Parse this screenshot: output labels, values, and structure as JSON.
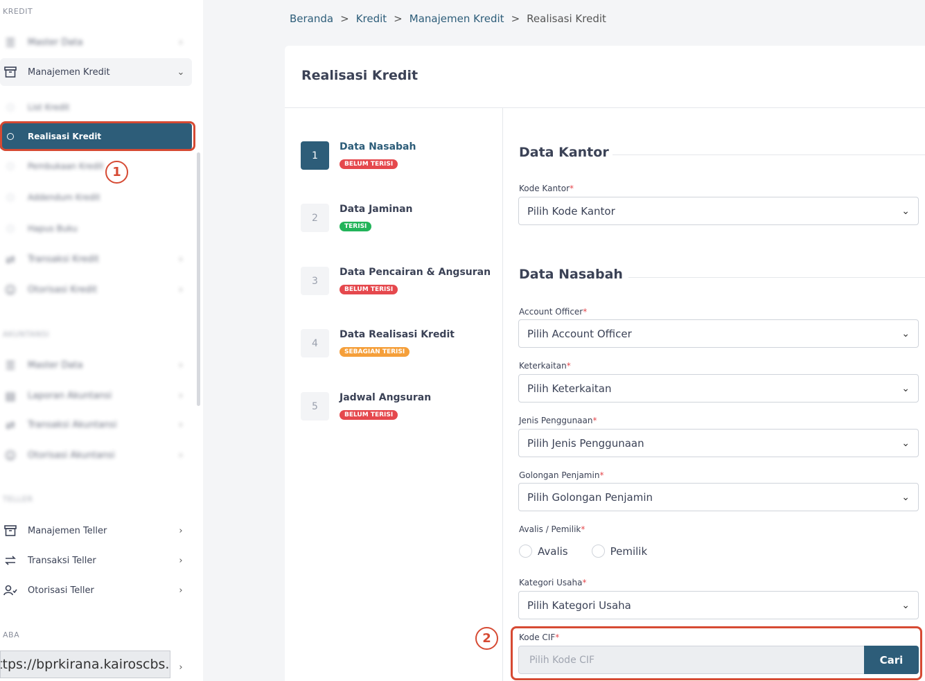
{
  "sidebar": {
    "sections": {
      "kredit": "KREDIT",
      "akuntansi": "AKUNTANSI",
      "teller": "TELLER",
      "aba": "ABA"
    },
    "kredit_items": {
      "master_data": "Master Data",
      "manajemen_kredit": "Manajemen Kredit",
      "transaksi_kredit": "Transaksi Kredit",
      "otorisasi_kredit": "Otorisasi Kredit"
    },
    "manajemen_sub": {
      "list_kredit": "List Kredit",
      "realisasi_kredit": "Realisasi Kredit",
      "pembukaan_kredit": "Pembukaan Kredit",
      "addendum_kredit": "Addendum Kredit",
      "hapus_buku": "Hapus Buku"
    },
    "akuntansi_items": {
      "master_data": "Master Data",
      "laporan_akuntansi": "Laporan Akuntansi",
      "transaksi_akuntansi": "Transaksi Akuntansi",
      "otorisasi_akuntansi": "Otorisasi Akuntansi"
    },
    "teller_items": {
      "manajemen_teller": "Manajemen Teller",
      "transaksi_teller": "Transaksi Teller",
      "otorisasi_teller": "Otorisasi Teller"
    },
    "status_url": "https://bprkirana.kairoscbs.id"
  },
  "annotations": {
    "marker_1": "1",
    "marker_2": "2",
    "color": "#d64a33"
  },
  "breadcrumb": {
    "beranda": "Beranda",
    "kredit": "Kredit",
    "manajemen_kredit": "Manajemen Kredit",
    "current": "Realisasi Kredit",
    "separator": ">"
  },
  "card": {
    "title": "Realisasi Kredit"
  },
  "steps": [
    {
      "num": "1",
      "title": "Data Nasabah",
      "status": "BELUM TERISI",
      "color": "#e5484d"
    },
    {
      "num": "2",
      "title": "Data Jaminan",
      "status": "TERISI",
      "color": "#22b45a"
    },
    {
      "num": "3",
      "title": "Data Pencairan & Angsuran",
      "status": "BELUM TERISI",
      "color": "#e5484d"
    },
    {
      "num": "4",
      "title": "Data Realisasi Kredit",
      "status": "SEBAGIAN TERISI",
      "color": "#f59f3a"
    },
    {
      "num": "5",
      "title": "Jadwal Angsuran",
      "status": "BELUM TERISI",
      "color": "#e5484d"
    }
  ],
  "form": {
    "data_kantor": {
      "heading": "Data Kantor",
      "kode_kantor_label": "Kode Kantor",
      "kode_kantor_value": "Pilih Kode Kantor"
    },
    "data_nasabah": {
      "heading": "Data Nasabah",
      "account_officer_label": "Account Officer",
      "account_officer_value": "Pilih Account Officer",
      "keterkaitan_label": "Keterkaitan",
      "keterkaitan_value": "Pilih Keterkaitan",
      "jenis_penggunaan_label": "Jenis Penggunaan",
      "jenis_penggunaan_value": "Pilih Jenis Penggunaan",
      "golongan_penjamin_label": "Golongan Penjamin",
      "golongan_penjamin_value": "Pilih Golongan Penjamin",
      "avalis_pemilik_label": "Avalis / Pemilik",
      "radio_avalis": "Avalis",
      "radio_pemilik": "Pemilik",
      "kategori_usaha_label": "Kategori Usaha",
      "kategori_usaha_value": "Pilih Kategori Usaha",
      "kode_cif_label": "Kode CIF",
      "kode_cif_placeholder": "Pilih Kode CIF",
      "cari_button": "Cari"
    },
    "required_mark": "*"
  },
  "colors": {
    "primary": "#2d5d79",
    "required": "#e5484d"
  }
}
